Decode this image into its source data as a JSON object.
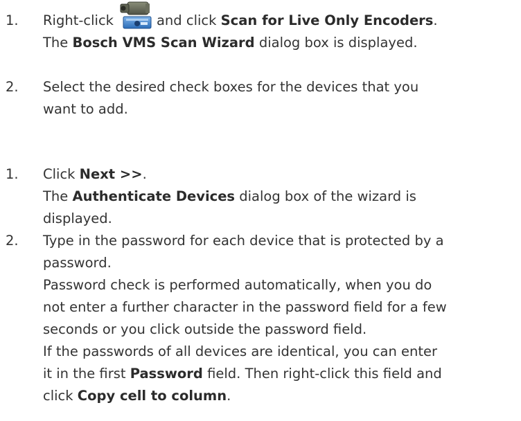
{
  "steps_a": [
    {
      "num": "1.",
      "pre": "Right-click",
      "icon": "video-encoder-icon",
      "mid": "and click",
      "bold": "Scan for Live Only Encoders",
      "post": ".",
      "line2_pre": "The",
      "line2_bold": "Bosch VMS Scan Wizard",
      "line2_post": "dialog box is displayed."
    },
    {
      "num": "2.",
      "line1": "Select the desired check boxes for the devices that you",
      "line2": "want to add."
    }
  ],
  "steps_b": [
    {
      "num": "1.",
      "pre": "Click",
      "bold": "Next >>",
      "post": ".",
      "line2_pre": "The",
      "line2_bold": "Authenticate Devices",
      "line2_post": "dialog box of the wizard is",
      "line3": "displayed."
    },
    {
      "num": "2.",
      "lines": [
        "Type in the password for each device that is protected by a",
        "password.",
        "Password check is performed automatically, when you do",
        "not enter a further character in the password field for a few",
        "seconds or you click outside the password field.",
        "If the passwords of all devices are identical, you can enter"
      ],
      "pw_pre": "it in the first",
      "pw_bold": "Password",
      "pw_post": "field. Then right-click this field and",
      "last_pre": "click",
      "last_bold": "Copy cell to column",
      "last_post": "."
    }
  ]
}
